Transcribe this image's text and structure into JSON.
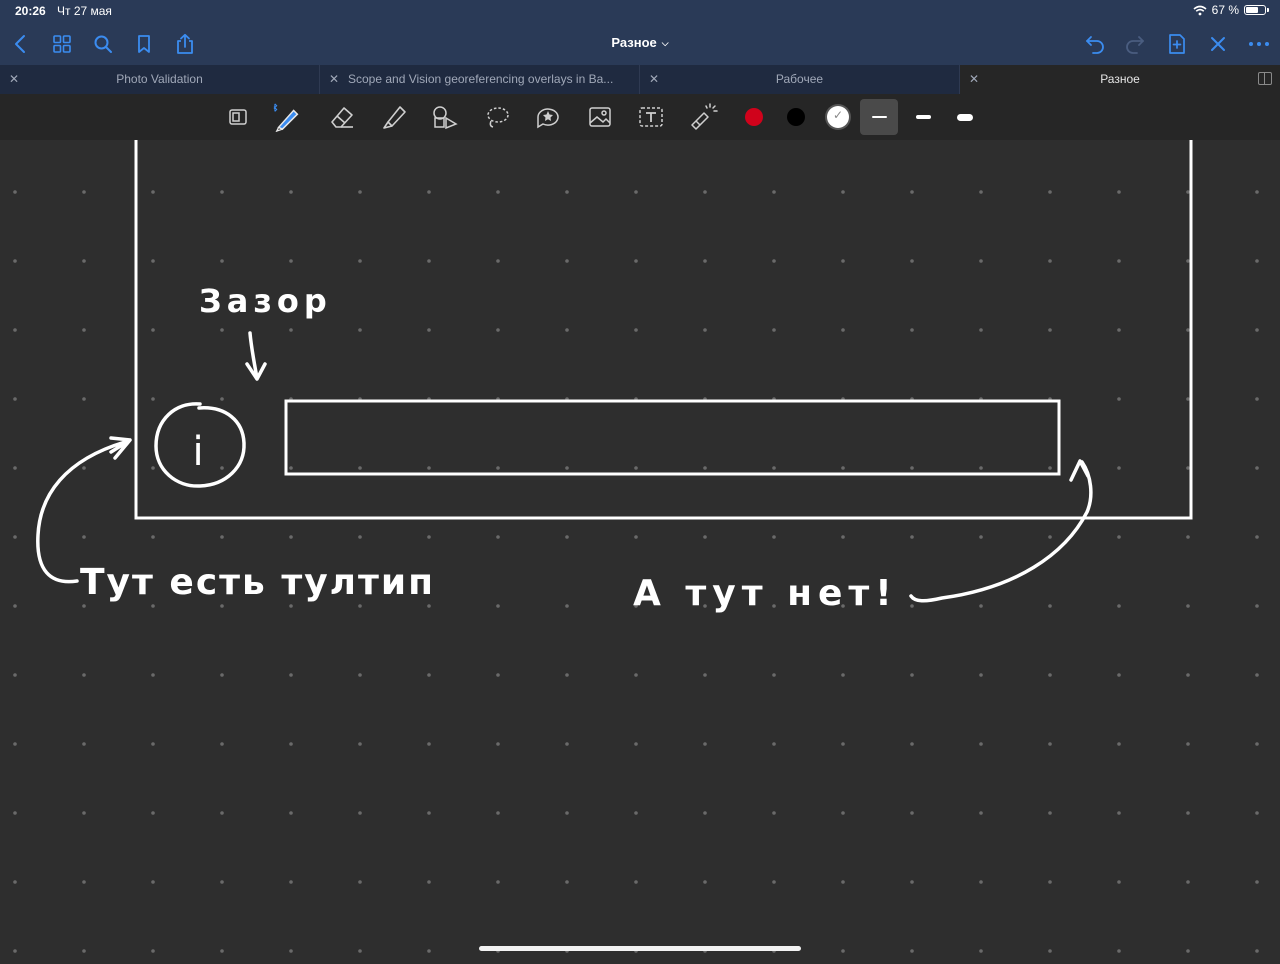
{
  "status_bar": {
    "time": "20:26",
    "date": "Чт 27 мая",
    "battery_percent": "67 %",
    "battery_level": 0.67
  },
  "nav": {
    "title": "Разное",
    "left_icons": [
      "back-chevron-icon",
      "grid-icon",
      "search-icon",
      "bookmark-icon",
      "share-icon"
    ],
    "right_icons": [
      "undo-icon",
      "redo-icon",
      "add-page-icon",
      "pen-off-icon",
      "more-icon"
    ]
  },
  "tabs": [
    {
      "label": "Photo Validation",
      "active": false
    },
    {
      "label": "Scope and Vision georeferencing overlays in Ba...",
      "active": false
    },
    {
      "label": "Рабочее",
      "active": false
    },
    {
      "label": "Разное",
      "active": true
    }
  ],
  "toolbar": {
    "tools": [
      "page-view",
      "pen",
      "eraser",
      "highlighter",
      "shapes",
      "lasso",
      "sticker",
      "image",
      "text",
      "laser-pointer"
    ],
    "selected_tool": "pen",
    "colors": [
      "#d0021b",
      "#000000",
      "#ffffff"
    ],
    "selected_color": "#ffffff",
    "selected_stroke": 0
  },
  "colors": {
    "nav_bg": "#2a3a57",
    "accent": "#3b8cf0",
    "canvas_bg": "#2e2e2e",
    "ink": "#ffffff"
  },
  "annotations": {
    "gap": "Зазор",
    "has_tooltip": "Тут есть тултип",
    "no_tooltip": "А тут нет!",
    "info_glyph": "i"
  }
}
